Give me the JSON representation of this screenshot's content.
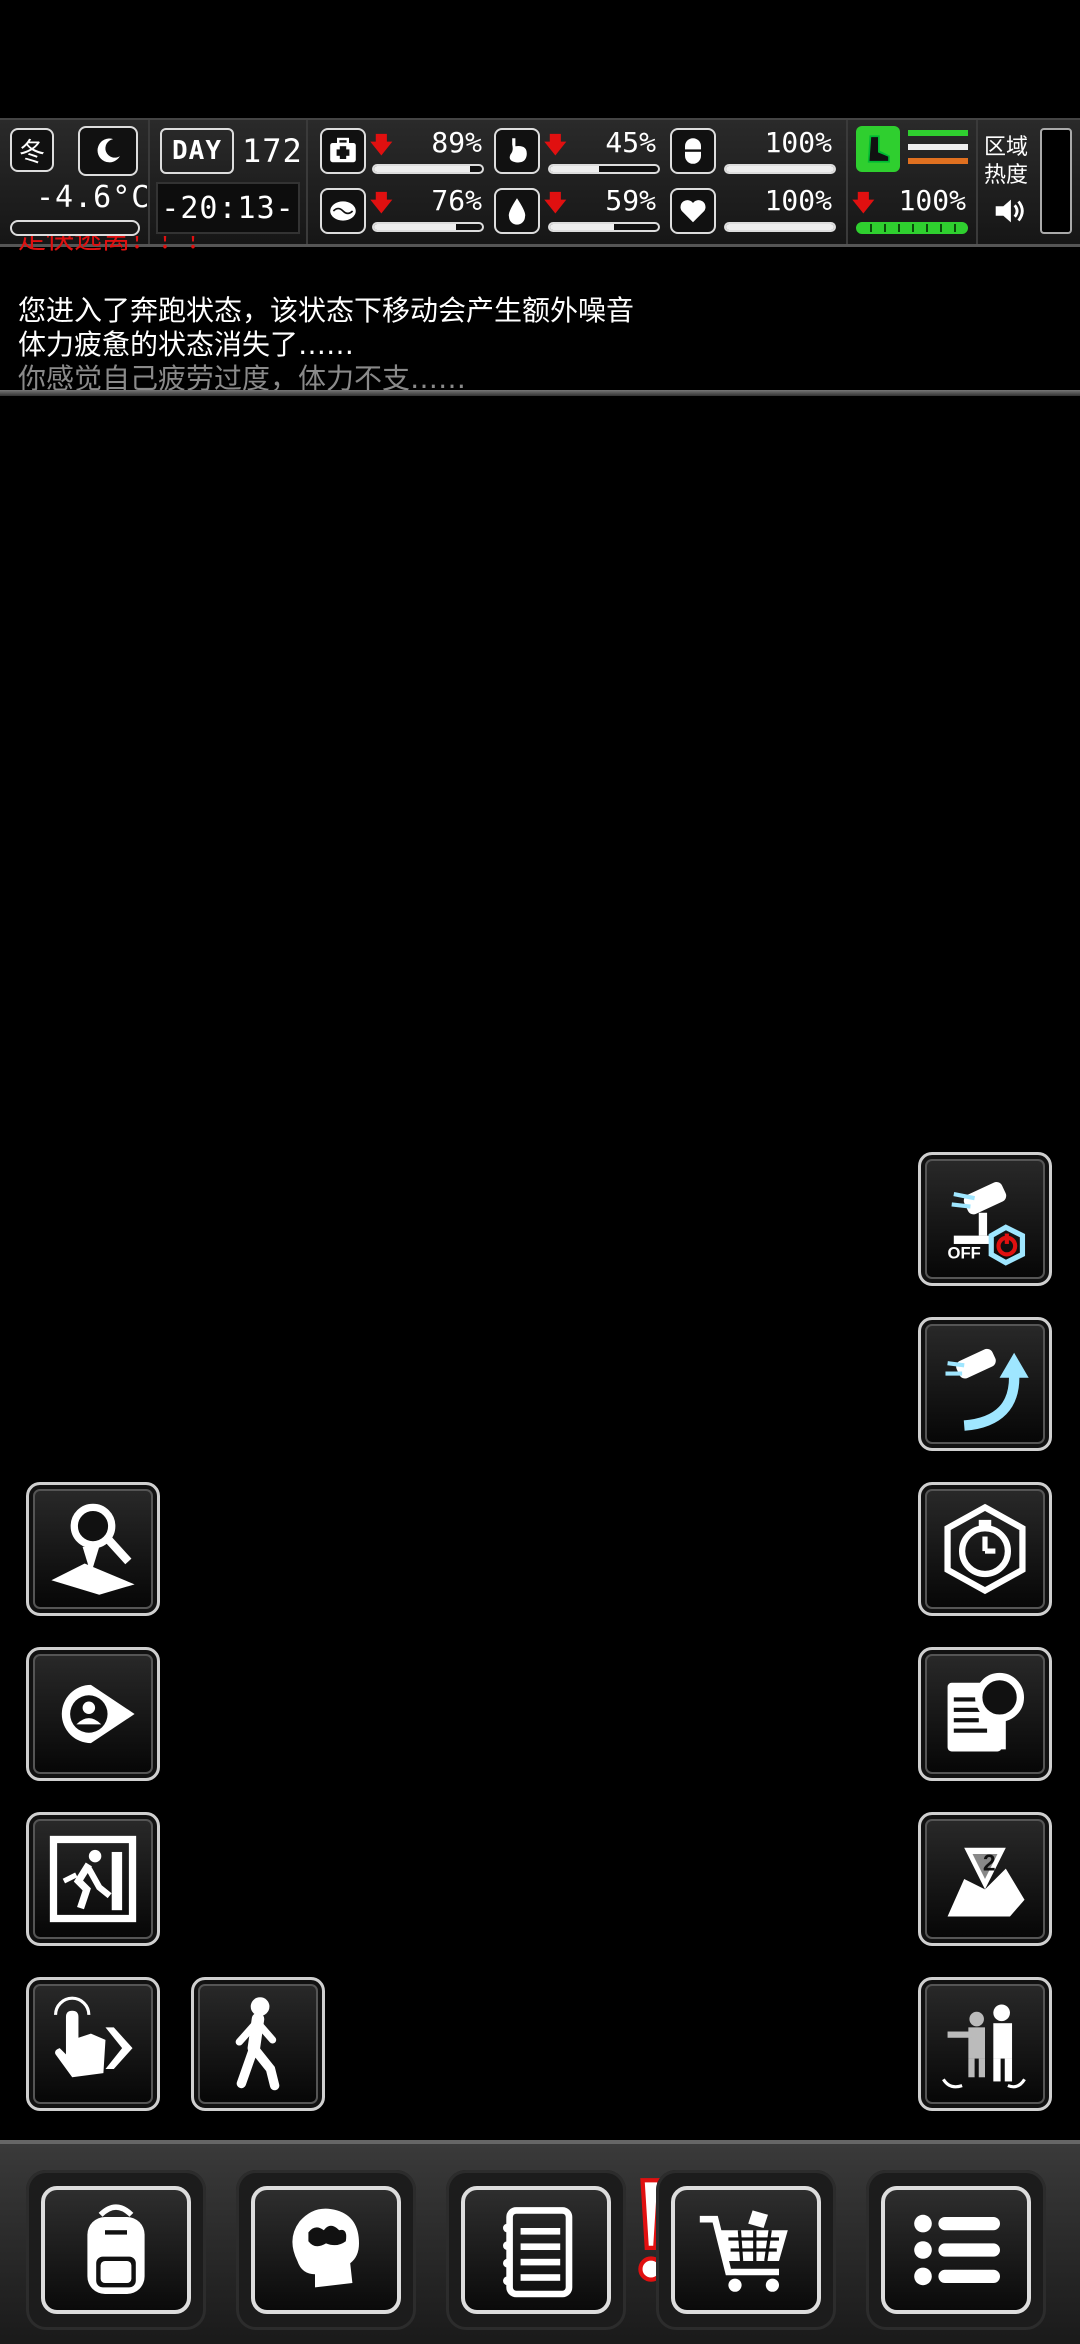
{
  "hud": {
    "season": "冬",
    "temperature": "-4.6°C",
    "day_label": "DAY",
    "day_number": "172",
    "time": "-20:13-",
    "stats": [
      {
        "name": "health",
        "value": "89%",
        "fill": 0.89,
        "down": true
      },
      {
        "name": "hunger",
        "value": "45%",
        "fill": 0.45,
        "down": true
      },
      {
        "name": "pill",
        "value": "100%",
        "fill": 1.0,
        "down": false
      },
      {
        "name": "sanity",
        "value": "76%",
        "fill": 0.76,
        "down": true
      },
      {
        "name": "thirst",
        "value": "59%",
        "fill": 0.59,
        "down": true
      },
      {
        "name": "heart",
        "value": "100%",
        "fill": 1.0,
        "down": false
      }
    ],
    "stamina": {
      "value": "100%",
      "fill": 1.0,
      "down": true
    },
    "zone_heat_label": "区域热度"
  },
  "log": {
    "cut_line": "走快逃离！！！",
    "lines": [
      "您进入了奔跑状态，该状态下移动会产生额外噪音",
      "体力疲惫的状态消失了……",
      "你感觉自己疲劳过度，体力不支……"
    ]
  },
  "buttons": {
    "right": [
      "attack-off-icon",
      "charge-attack-icon",
      "timer-icon",
      "search-report-icon",
      "map-level-icon",
      "ally-swap-icon"
    ],
    "left": [
      "search-area-icon",
      "locate-person-icon",
      "exit-icon",
      "tap-next-icon",
      "walk-icon"
    ]
  },
  "bottom_tabs": [
    "backpack-icon",
    "brain-icon",
    "notebook-icon",
    "cart-icon",
    "menu-icon"
  ],
  "colors": {
    "accent_green": "#2fcf2f",
    "alert_red": "#e01010",
    "orange": "#e07020"
  }
}
